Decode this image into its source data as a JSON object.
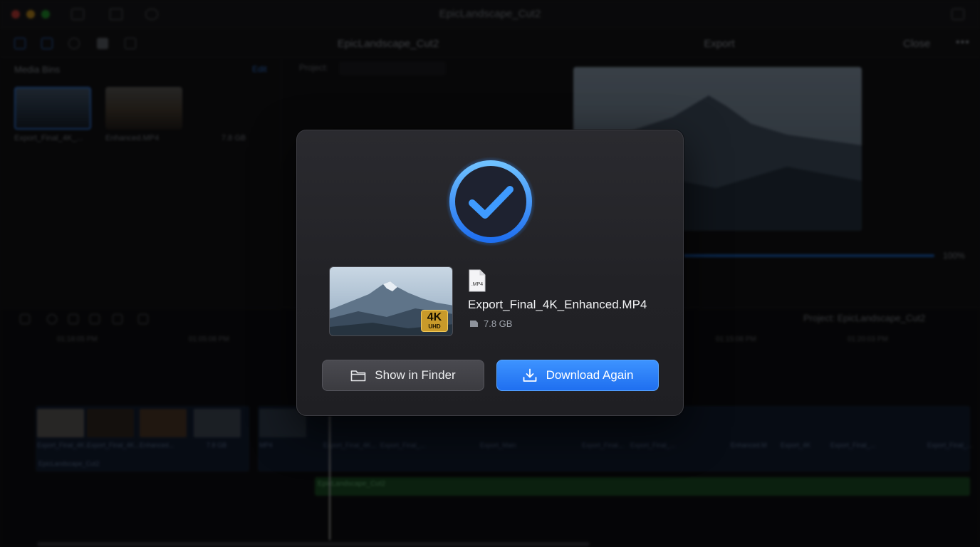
{
  "window": {
    "title": "EpicLandscape_Cut2"
  },
  "toolbar": {
    "project_title": "EpicLandscape_Cut2",
    "export_title": "Export",
    "close_label": "Close"
  },
  "media_bins": {
    "title": "Media Bins",
    "edit_label": "Edit",
    "items": [
      {
        "caption": "Export_Final_4K_..."
      },
      {
        "caption": "Enhanced.MP4"
      },
      {
        "caption": "7.8 GB"
      }
    ]
  },
  "project_label": "Project:",
  "viewer": {
    "progress_percent": 100,
    "progress_label": "100%"
  },
  "timeline": {
    "project_label": "Project:",
    "project_name": "EpicLandscape_Cut2",
    "ruler": [
      "01:18:05 PM",
      "01:05:08 PM",
      "01:15:08 PM",
      "01:20:03 PM"
    ],
    "track_name": "EpicLandscape_Cut2",
    "audio_label": "EpicLandscape_Cut2",
    "clip_labels": [
      "Export_Final_4K...",
      "Export_Final_4K...",
      "Enhanced...",
      "7.8 GB",
      "MP4",
      "Export_Final_4K...",
      "Export_Final_...",
      "Export_Main",
      "Export_Final...",
      "Export_Final_...",
      "Enhanced.M",
      "Export_4K",
      "Export_Final_...",
      "Export_Final_..."
    ]
  },
  "modal": {
    "status_icon": "checkmark-circle-icon",
    "thumbnail_badge_top": "4K",
    "thumbnail_badge_bottom": "UHD",
    "file_icon_label": ".MP4",
    "file_name": "Export_Final_4K_Enhanced.MP4",
    "file_size": "7.8 GB",
    "show_in_finder_label": "Show in Finder",
    "download_again_label": "Download Again"
  },
  "colors": {
    "accent": "#1f6ff0",
    "accent_glow": "#2f8bff",
    "badge_gold": "#c99a2a",
    "modal_bg": "#242428"
  }
}
